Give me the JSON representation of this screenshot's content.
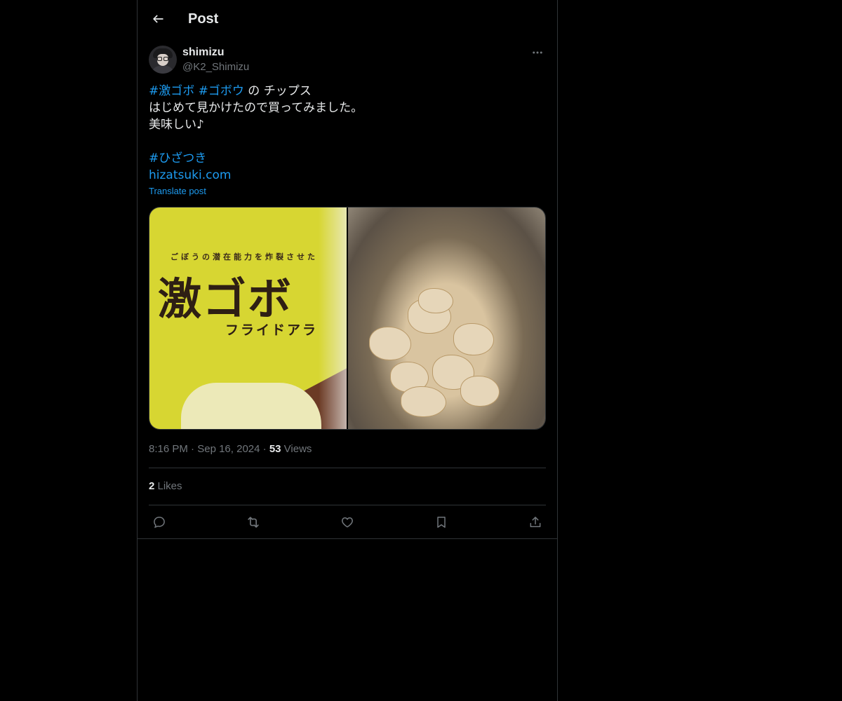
{
  "header": {
    "title": "Post",
    "back_icon": "arrow-left-icon"
  },
  "author": {
    "display_name": "shimizu",
    "handle": "@K2_Shimizu",
    "more_icon": "more-horizontal-icon"
  },
  "tweet": {
    "hashtag_1": "#激ゴボ",
    "hashtag_2": "#ゴボウ",
    "line1_rest": " の チップス",
    "line2": "はじめて見かけたので買ってみました。",
    "line3": "美味しい♪",
    "hashtag_3": "#ひざつき",
    "link": "hizatsuki.com",
    "translate": "Translate post"
  },
  "media": {
    "photo_left": {
      "sub_text": "ごぼうの潜在能力を炸裂させた",
      "big_text": "激ゴボ",
      "mid_text": "フライドアラ"
    }
  },
  "meta": {
    "time": "8:16 PM",
    "sep1": " · ",
    "date": "Sep 16, 2024",
    "sep2": " · ",
    "views_count": "53",
    "views_label": " Views"
  },
  "likes": {
    "count": "2",
    "label": " Likes"
  },
  "actions": [
    "reply-icon",
    "retweet-icon",
    "like-icon",
    "bookmark-icon",
    "share-icon"
  ],
  "colors": {
    "background": "#000000",
    "text": "#e7e9ea",
    "muted": "#71767b",
    "accent": "#1d9bf0",
    "border": "#2f3336"
  }
}
